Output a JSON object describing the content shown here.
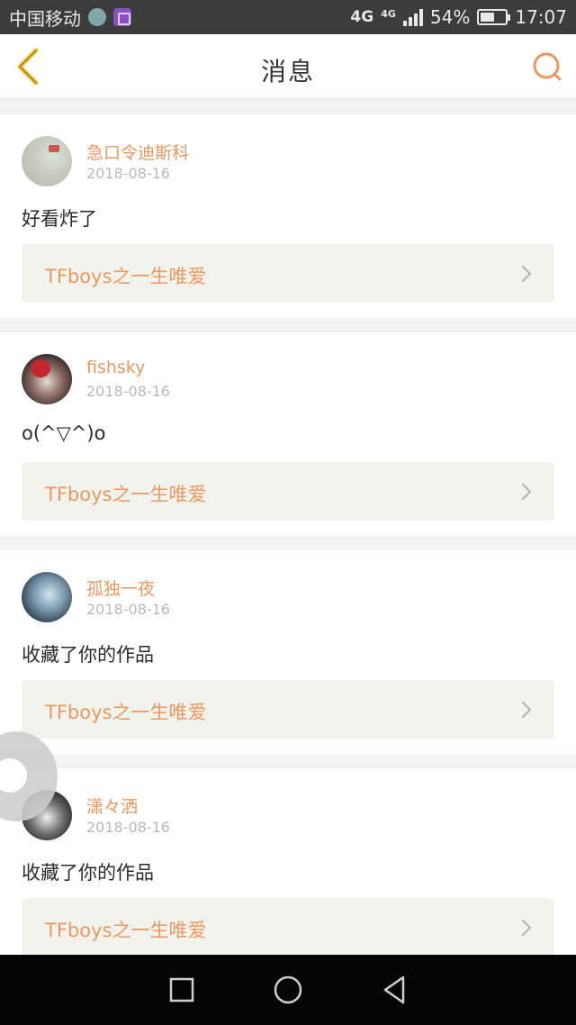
{
  "status_bar": {
    "carrier": "中国移动",
    "network": "4G",
    "network2": "4G",
    "battery": "54%",
    "time": "17:07"
  },
  "header": {
    "title": "消息",
    "back_icon": "chevron-left-icon",
    "search_icon": "search-icon"
  },
  "colors": {
    "accent": "#e99860",
    "back_icon": "#f1c232"
  },
  "messages": [
    {
      "name": "急口令迪斯科",
      "date": "2018-08-16",
      "text": "好看炸了",
      "work_title": "TFboys之一生唯爱"
    },
    {
      "name": "fishsky",
      "date": "2018-08-16",
      "text": "o(^▽^)o",
      "work_title": "TFboys之一生唯爱"
    },
    {
      "name": "孤独一夜",
      "date": "2018-08-16",
      "text": "收藏了你的作品",
      "work_title": "TFboys之一生唯爱"
    },
    {
      "name": "潇々洒",
      "date": "2018-08-16",
      "text": "收藏了你的作品",
      "work_title": "TFboys之一生唯爱"
    }
  ]
}
